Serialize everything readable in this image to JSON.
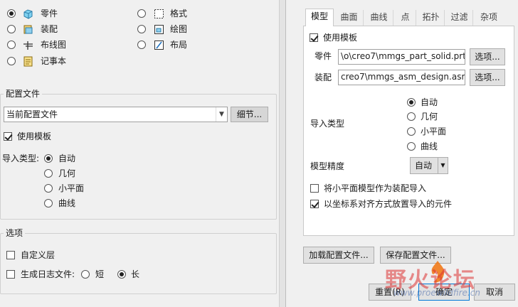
{
  "left": {
    "types": [
      {
        "label": "零件",
        "selected": true,
        "icon": "part-icon"
      },
      {
        "label": "装配",
        "selected": false,
        "icon": "assembly-icon"
      },
      {
        "label": "布线图",
        "selected": false,
        "icon": "harness-icon"
      },
      {
        "label": "记事本",
        "selected": false,
        "icon": "notebook-icon"
      },
      {
        "label": "格式",
        "selected": false,
        "icon": "format-icon"
      },
      {
        "label": "绘图",
        "selected": false,
        "icon": "drawing-icon"
      },
      {
        "label": "布局",
        "selected": false,
        "icon": "layout-icon"
      }
    ],
    "config": {
      "title": "配置文件",
      "dropdown_value": "当前配置文件",
      "details_button": "细节...",
      "use_template": "使用模板",
      "import_type_label": "导入类型:",
      "import_options": [
        "自动",
        "几何",
        "小平面",
        "曲线"
      ],
      "selected_import": "自动"
    },
    "options": {
      "title": "选项",
      "custom_layer": "自定义层",
      "log_label": "生成日志文件:",
      "log_short": "短",
      "log_long": "长"
    }
  },
  "right": {
    "tabs": [
      "模型",
      "曲面",
      "曲线",
      "点",
      "拓扑",
      "过滤",
      "杂项"
    ],
    "active_tab": "模型",
    "use_template": "使用模板",
    "part_label": "零件",
    "part_path": "\\o\\creo7\\mmgs_part_solid.prt",
    "part_button": "选项...",
    "asm_label": "装配",
    "asm_path": "creo7\\mmgs_asm_design.asm",
    "asm_button": "选项...",
    "import_type_label": "导入类型",
    "import_options": [
      "自动",
      "几何",
      "小平面",
      "曲线"
    ],
    "selected_import": "自动",
    "precision_label": "模型精度",
    "precision_value": "自动",
    "facet_as_asm": "将小平面模型作为装配导入",
    "align_csys": "以坐标系对齐方式放置导入的元件",
    "load_config": "加载配置文件...",
    "save_config": "保存配置文件...",
    "reset": "重置(R)",
    "ok": "确定",
    "cancel": "取消"
  },
  "watermark": {
    "text": "野火论坛",
    "url": "www.proewildfire.cn"
  }
}
